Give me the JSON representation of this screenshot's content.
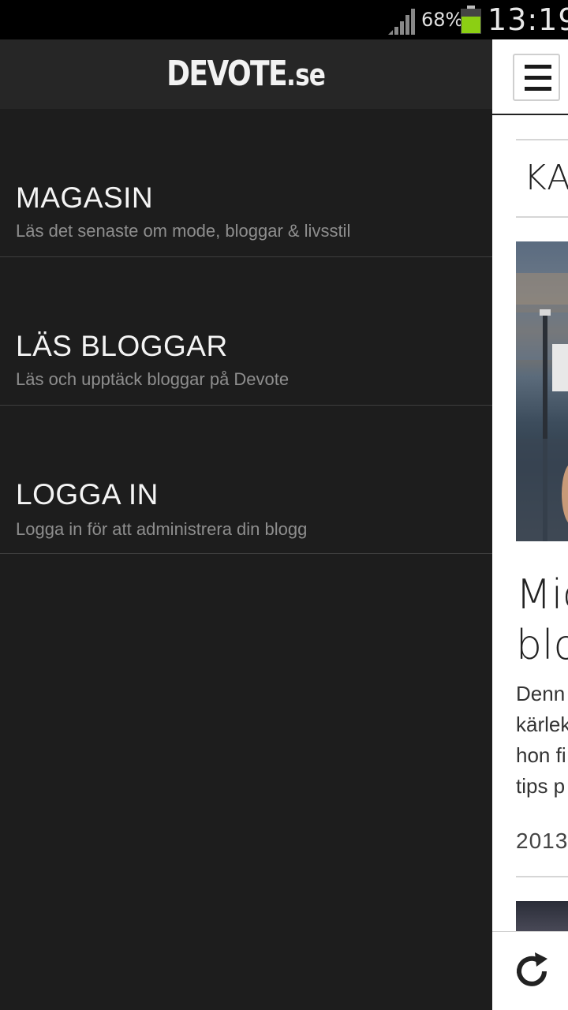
{
  "status_bar": {
    "battery_percent": "68%",
    "time": "13:19",
    "battery_color": "#8ccf13"
  },
  "drawer": {
    "logo": {
      "main": "DEVOTE",
      "suffix": ".se"
    },
    "items": [
      {
        "title": "MAGASIN",
        "subtitle": "Läs det senaste om mode, bloggar & livsstil"
      },
      {
        "title": "LÄS BLOGGAR",
        "subtitle": "Läs och upptäck bloggar på Devote"
      },
      {
        "title": "LOGGA IN",
        "subtitle": "Logga in för att administrera din blogg"
      }
    ]
  },
  "content": {
    "category": "KA",
    "article_title_lines": [
      "Mic",
      "blo"
    ],
    "article_excerpt_lines": [
      "Denn",
      "kärlek",
      "hon fi",
      "tips p"
    ],
    "article_date": "2013-"
  },
  "icons": {
    "menu": "hamburger-icon",
    "refresh": "refresh-icon",
    "signal": "signal-icon",
    "battery": "battery-icon"
  }
}
